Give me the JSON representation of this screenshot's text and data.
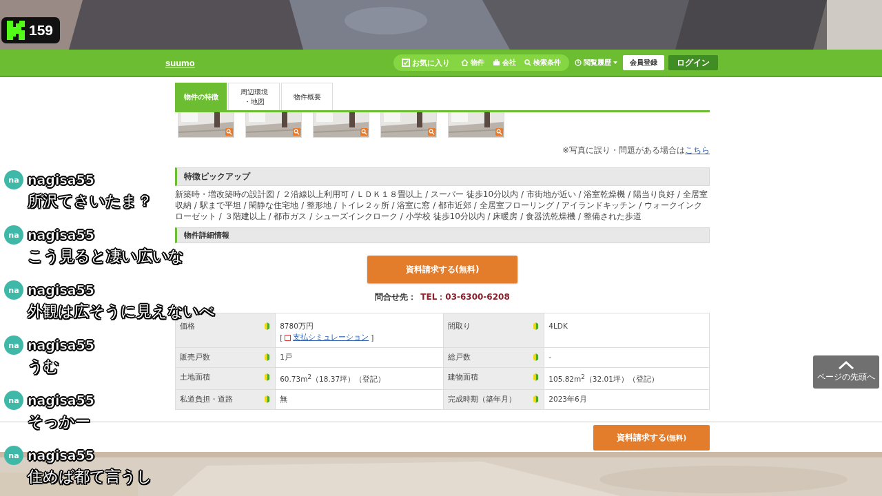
{
  "viewer_badge": {
    "count": "159"
  },
  "header": {
    "logo": "suumo",
    "nav": [
      {
        "label": "お気に入り",
        "kind": "fav"
      },
      {
        "label": "物件",
        "kind": "home"
      },
      {
        "label": "会社",
        "kind": "company"
      },
      {
        "label": "検索条件",
        "kind": "search"
      }
    ],
    "history": "閲覧履歴",
    "register": "会員登録",
    "login": "ログイン"
  },
  "tabs": [
    {
      "lines": [
        "物件の特徴"
      ],
      "selected": true
    },
    {
      "lines": [
        "周辺環境",
        "・地図"
      ],
      "selected": false
    },
    {
      "lines": [
        "物件概要"
      ],
      "selected": false
    }
  ],
  "photo_note": {
    "text": "※写真に誤り・問題がある場合は",
    "link": "こちら"
  },
  "features": {
    "title": "特徴ピックアップ",
    "text": "新築時・増改築時の設計図 / ２沿線以上利用可 / ＬＤＫ１８畳以上 / スーパー 徒歩10分以内 / 市街地が近い / 浴室乾燥機 / 陽当り良好 / 全居室収納 / 駅まで平坦 / 閑静な住宅地 / 整形地 / トイレ２ヶ所 / 浴室に窓 / 都市近郊 / 全居室フローリング / アイランドキッチン / ウォークインクローゼット / ３階建以上 / 都市ガス / シューズインクローク / 小学校 徒歩10分以内 / 床暖房 / 食器洗乾燥機 / 整備された歩道"
  },
  "details": {
    "title": "物件詳細情報",
    "request_button": "資料請求する(無料)",
    "contact_label": "問合せ先：",
    "tel": "TEL：03-6300-6208",
    "rows": [
      [
        {
          "label": "価格",
          "value": "8780万円",
          "link_open": "[",
          "link": "支払シミュレーション",
          "link_close": "]"
        },
        {
          "label": "間取り",
          "value": "4LDK"
        }
      ],
      [
        {
          "label": "販売戸数",
          "value": "1戸"
        },
        {
          "label": "総戸数",
          "value": "-"
        }
      ],
      [
        {
          "label": "土地面積",
          "value": "60.73m$^{2}$（18.37坪）（登記）"
        },
        {
          "label": "建物面積",
          "value": "105.82m$^{2}$（32.01坪）（登記）"
        }
      ],
      [
        {
          "label": "私道負担・道路",
          "value": "無"
        },
        {
          "label": "完成時期（築年月）",
          "value": "2023年6月"
        }
      ]
    ]
  },
  "page_top": "ページの先頭へ",
  "sticky_button": {
    "main": "資料請求する",
    "sub": "(無料)"
  },
  "chat": [
    {
      "avatar": "na",
      "name": "nagisa55",
      "message": "所沢てさいたま？"
    },
    {
      "avatar": "na",
      "name": "nagisa55",
      "message": "こう見ると凄い広いな"
    },
    {
      "avatar": "na",
      "name": "nagisa55",
      "message": "外観は広そうに見えないべ"
    },
    {
      "avatar": "na",
      "name": "nagisa55",
      "message": "うむ"
    },
    {
      "avatar": "na",
      "name": "nagisa55",
      "message": "そっかー"
    },
    {
      "avatar": "na",
      "name": "nagisa55",
      "message": "住めば都て言うし"
    }
  ]
}
